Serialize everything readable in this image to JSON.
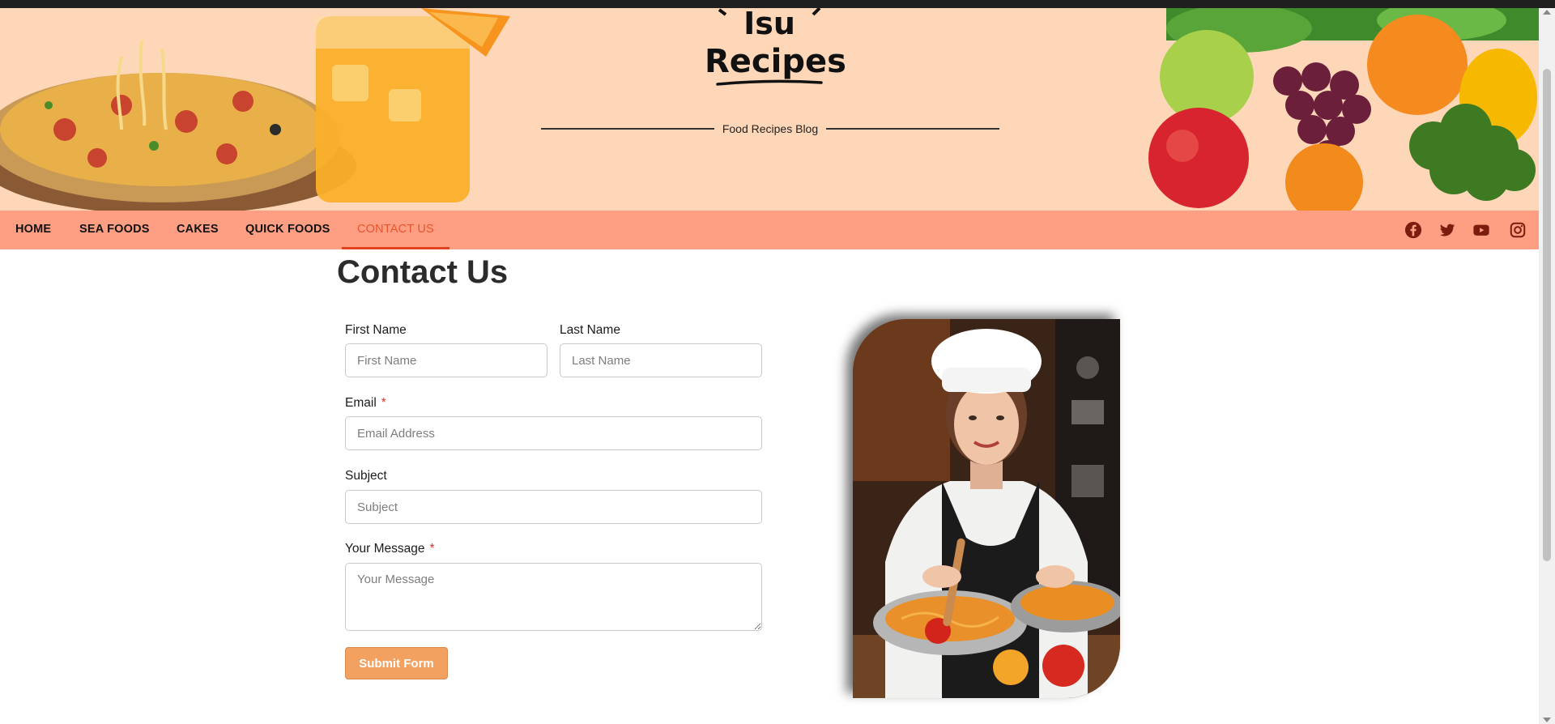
{
  "site": {
    "logo_line1": "Isu",
    "logo_line2": "Recipes",
    "tagline": "Food Recipes Blog"
  },
  "nav": {
    "items": [
      {
        "label": "HOME"
      },
      {
        "label": "SEA FOODS"
      },
      {
        "label": "CAKES"
      },
      {
        "label": "QUICK FOODS"
      },
      {
        "label": "CONTACT US"
      }
    ],
    "active_index": 4,
    "social_icons": [
      "facebook-icon",
      "twitter-icon",
      "youtube-icon",
      "instagram-icon"
    ]
  },
  "page": {
    "title": "Contact Us"
  },
  "form": {
    "first_name": {
      "label": "First Name",
      "placeholder": "First Name",
      "value": ""
    },
    "last_name": {
      "label": "Last Name",
      "placeholder": "Last Name",
      "value": ""
    },
    "email": {
      "label": "Email",
      "placeholder": "Email Address",
      "value": "",
      "required_mark": "*"
    },
    "subject": {
      "label": "Subject",
      "placeholder": "Subject",
      "value": ""
    },
    "message": {
      "label": "Your Message",
      "placeholder": "Your Message",
      "value": "",
      "required_mark": "*"
    },
    "submit_label": "Submit Form"
  },
  "colors": {
    "header_bg": "#fed7b9",
    "nav_bg": "#fe9f83",
    "nav_active": "#e8542c",
    "submit_bg": "#f2a160",
    "required": "#e5312c"
  }
}
